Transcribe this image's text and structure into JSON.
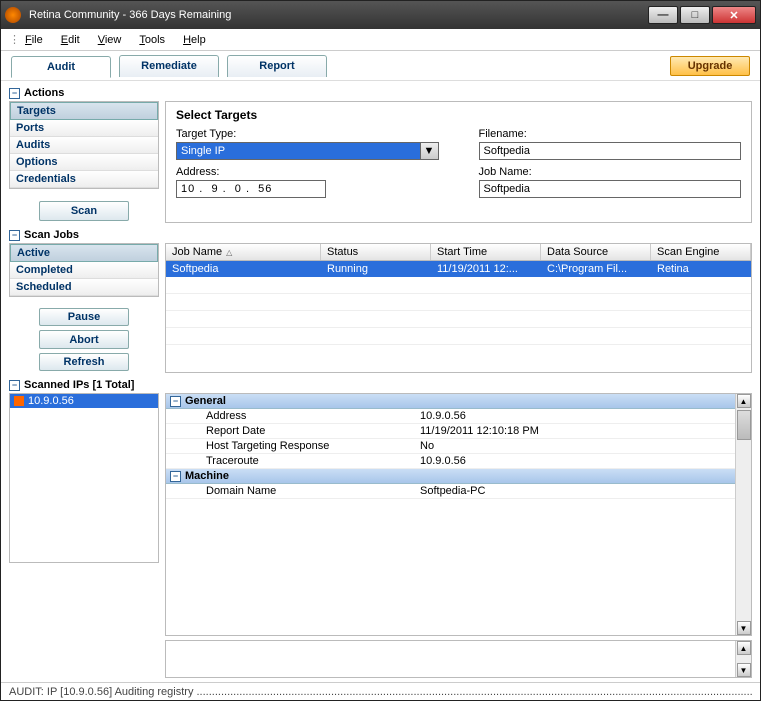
{
  "window": {
    "title": "Retina Community - 366  Days Remaining"
  },
  "menu": {
    "file": "File",
    "edit": "Edit",
    "view": "View",
    "tools": "Tools",
    "help": "Help"
  },
  "tabs": {
    "audit": "Audit",
    "remediate": "Remediate",
    "report": "Report",
    "upgrade": "Upgrade"
  },
  "sections": {
    "actions": "Actions",
    "scan_jobs": "Scan Jobs",
    "scanned_ips": "Scanned IPs [1 Total]"
  },
  "actions_nav": {
    "targets": "Targets",
    "ports": "Ports",
    "audits": "Audits",
    "options": "Options",
    "credentials": "Credentials"
  },
  "buttons": {
    "scan": "Scan",
    "pause": "Pause",
    "abort": "Abort",
    "refresh": "Refresh"
  },
  "targets_form": {
    "heading": "Select Targets",
    "target_type_label": "Target Type:",
    "target_type_value": "Single IP",
    "address_label": "Address:",
    "address_value": "10 .  9 .  0 .  56",
    "filename_label": "Filename:",
    "filename_value": "Softpedia",
    "jobname_label": "Job Name:",
    "jobname_value": "Softpedia"
  },
  "jobs_nav": {
    "active": "Active",
    "completed": "Completed",
    "scheduled": "Scheduled"
  },
  "jobs_table": {
    "cols": {
      "jobname": "Job Name",
      "status": "Status",
      "start": "Start Time",
      "src": "Data Source",
      "eng": "Scan Engine"
    },
    "row": {
      "jobname": "Softpedia",
      "status": "Running",
      "start": "11/19/2011 12:...",
      "src": "C:\\Program Fil...",
      "eng": "Retina"
    }
  },
  "ip_list": {
    "ip0": "10.9.0.56"
  },
  "propgrid": {
    "general": "General",
    "address_k": "Address",
    "address_v": "10.9.0.56",
    "report_k": "Report Date",
    "report_v": "11/19/2011 12:10:18 PM",
    "host_k": "Host Targeting Response",
    "host_v": "No",
    "trace_k": "Traceroute",
    "trace_v": "10.9.0.56",
    "machine": "Machine",
    "domain_k": "Domain Name",
    "domain_v": "Softpedia-PC"
  },
  "status": {
    "text": "AUDIT: IP [10.9.0.56] Auditing registry ............................................................................................................................................................................................"
  }
}
